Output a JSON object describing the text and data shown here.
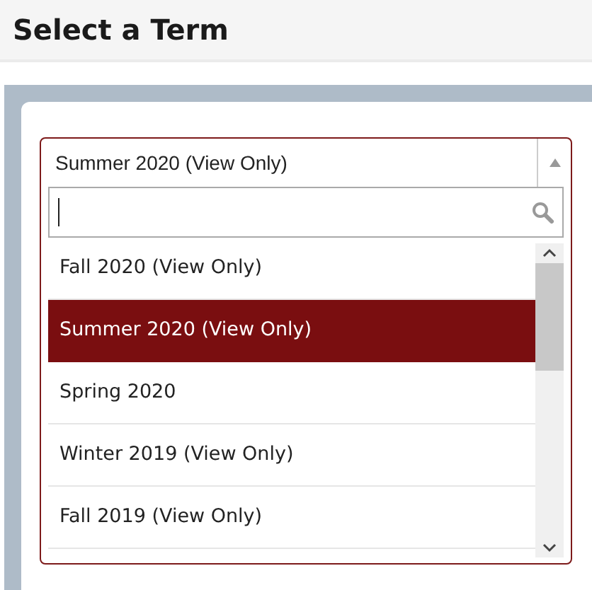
{
  "page_title": "Select a Term",
  "term_select": {
    "value": "Summer 2020 (View Only)",
    "expanded": true,
    "options": [
      {
        "label": "Fall 2020 (View Only)",
        "selected": false
      },
      {
        "label": "Summer 2020 (View Only)",
        "selected": true
      },
      {
        "label": "Spring 2020",
        "selected": false
      },
      {
        "label": "Winter 2019 (View Only)",
        "selected": false
      },
      {
        "label": "Fall 2019 (View Only)",
        "selected": false
      }
    ]
  }
}
